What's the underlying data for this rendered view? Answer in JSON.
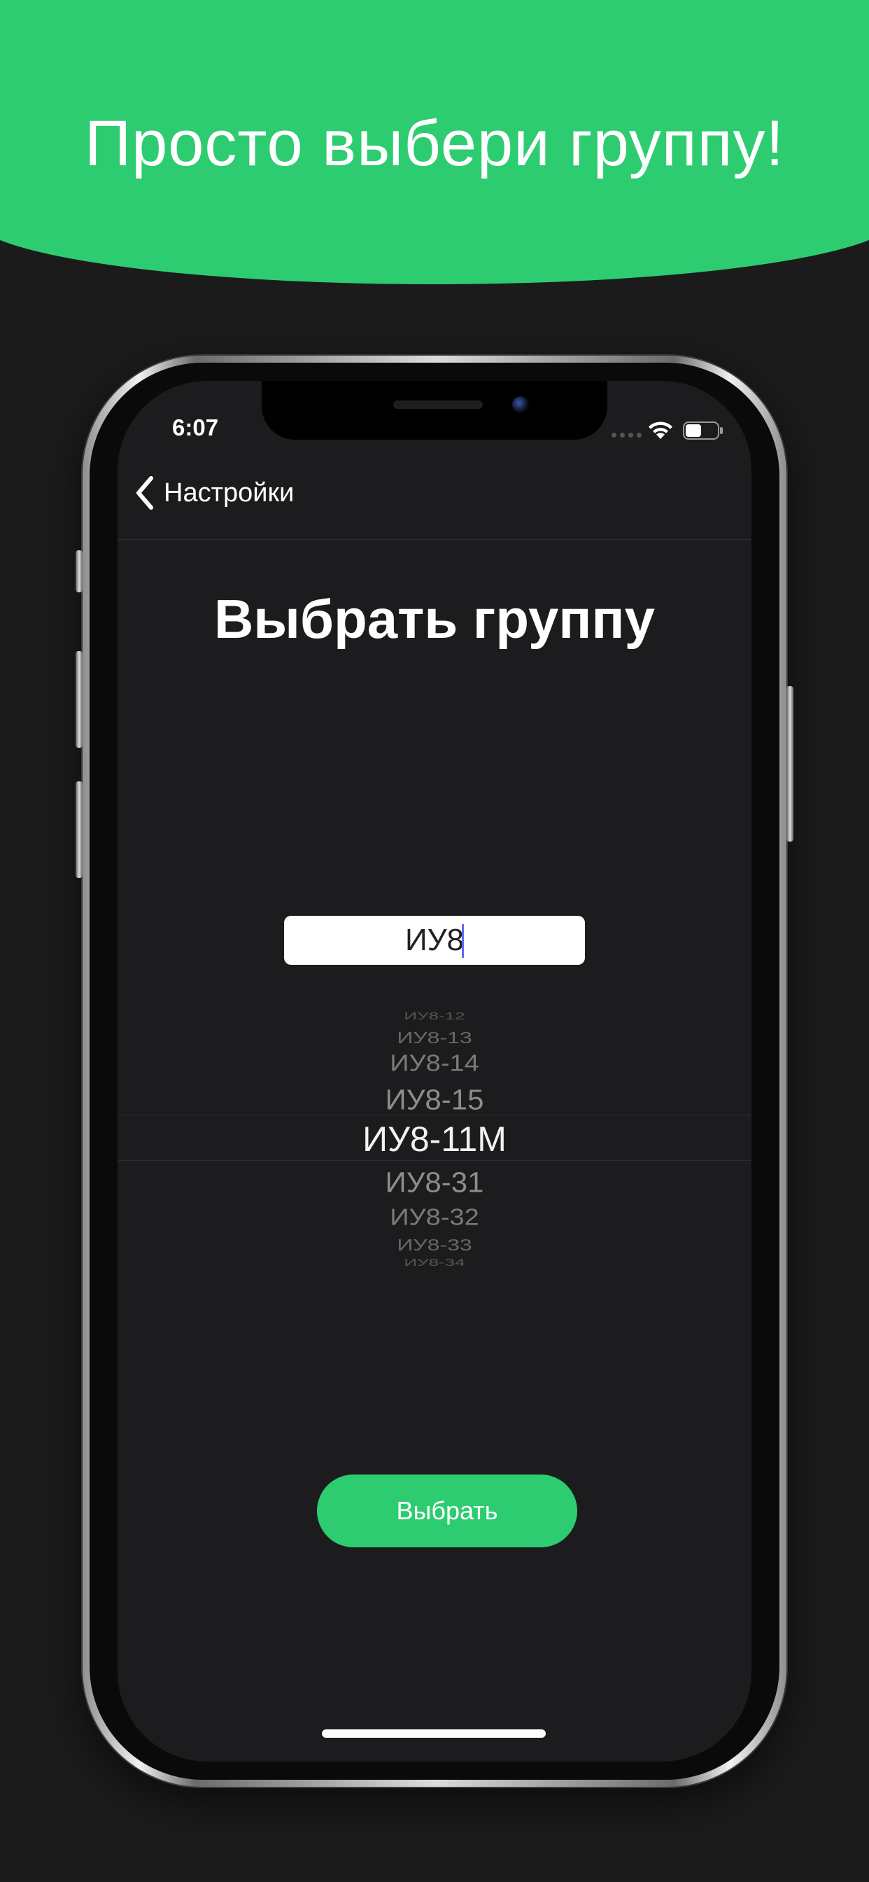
{
  "promo": {
    "title": "Просто выбери группу!",
    "banner_color": "#2ecc71"
  },
  "status_bar": {
    "time": "6:07",
    "icons": [
      "signal-dots-icon",
      "wifi-icon",
      "battery-icon"
    ],
    "battery_level": 0.5
  },
  "nav": {
    "back_label": "Настройки",
    "back_icon": "chevron-left-icon"
  },
  "page": {
    "title": "Выбрать группу"
  },
  "search": {
    "value": "ИУ8",
    "placeholder": ""
  },
  "picker": {
    "items": [
      "ИУ8-12",
      "ИУ8-13",
      "ИУ8-14",
      "ИУ8-15",
      "ИУ8-11М",
      "ИУ8-31",
      "ИУ8-32",
      "ИУ8-33",
      "ИУ8-34"
    ],
    "selected": "ИУ8-11М"
  },
  "actions": {
    "select_label": "Выбрать",
    "accent_color": "#2ecc71"
  },
  "colors": {
    "background": "#1b1b1b",
    "screen": "#1c1c1e"
  }
}
